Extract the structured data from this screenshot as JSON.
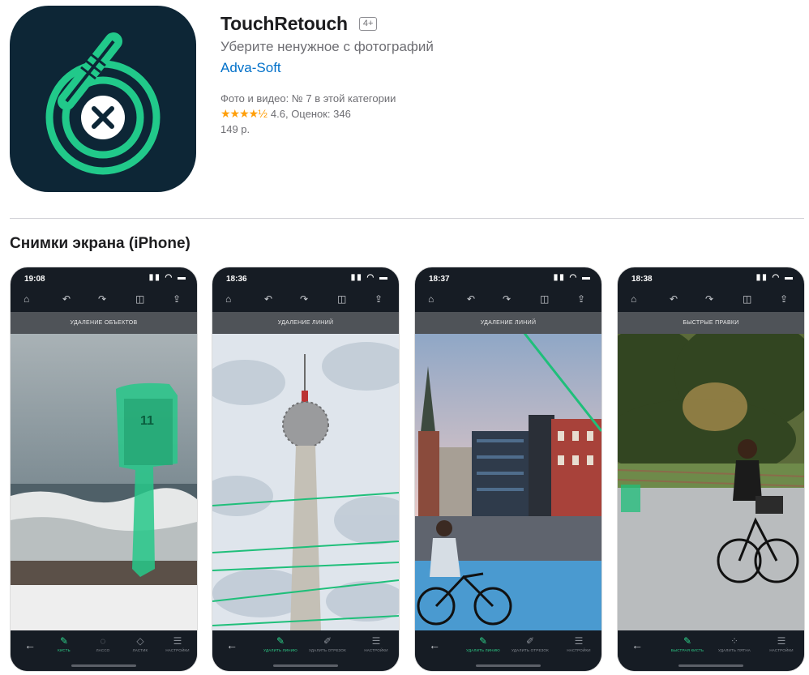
{
  "app": {
    "title": "TouchRetouch",
    "age_rating": "4+",
    "subtitle": "Уберите ненужное с фотографий",
    "developer": "Adva-Soft",
    "category_rank": "Фото и видео: № 7 в этой категории",
    "stars": "★★★★½",
    "rating_value": "4.6",
    "rating_count": ", Оценок: 346",
    "price": "149 р.",
    "icon_colors": {
      "background": "#0d2636",
      "accent": "#21c98a"
    }
  },
  "screenshots_section": {
    "title": "Снимки экрана (iPhone)"
  },
  "screenshots": [
    {
      "time": "19:08",
      "banner": "УДАЛЕНИЕ ОБЪЕКТОВ",
      "tools": [
        {
          "icon": "brush-icon",
          "label": "КИСТЬ",
          "active": true
        },
        {
          "icon": "lasso-icon",
          "label": "ЛАССО",
          "active": false
        },
        {
          "icon": "eraser-icon",
          "label": "ЛАСТИК",
          "active": false
        },
        {
          "icon": "settings-icon",
          "label": "НАСТРОЙКИ",
          "active": false
        }
      ]
    },
    {
      "time": "18:36",
      "banner": "УДАЛЕНИЕ ЛИНИЙ",
      "tools": [
        {
          "icon": "line-remover-icon",
          "label": "УДАЛИТЬ ЛИНИЮ",
          "active": true
        },
        {
          "icon": "segment-remover-icon",
          "label": "УДАЛИТЬ ОТРЕЗОК",
          "active": false
        },
        {
          "icon": "settings-icon",
          "label": "НАСТРОЙКИ",
          "active": false
        }
      ]
    },
    {
      "time": "18:37",
      "banner": "УДАЛЕНИЕ ЛИНИЙ",
      "tools": [
        {
          "icon": "line-remover-icon",
          "label": "УДАЛИТЬ ЛИНИЮ",
          "active": true
        },
        {
          "icon": "segment-remover-icon",
          "label": "УДАЛИТЬ ОТРЕЗОК",
          "active": false
        },
        {
          "icon": "settings-icon",
          "label": "НАСТРОЙКИ",
          "active": false
        }
      ]
    },
    {
      "time": "18:38",
      "banner": "БЫСТРЫЕ ПРАВКИ",
      "tools": [
        {
          "icon": "quick-repair-icon",
          "label": "БЫСТРАЯ КИСТЬ",
          "active": true
        },
        {
          "icon": "blemish-icon",
          "label": "УДАЛИТЬ ПЯТНА",
          "active": false
        },
        {
          "icon": "settings-icon",
          "label": "НАСТРОЙКИ",
          "active": false
        }
      ]
    }
  ]
}
